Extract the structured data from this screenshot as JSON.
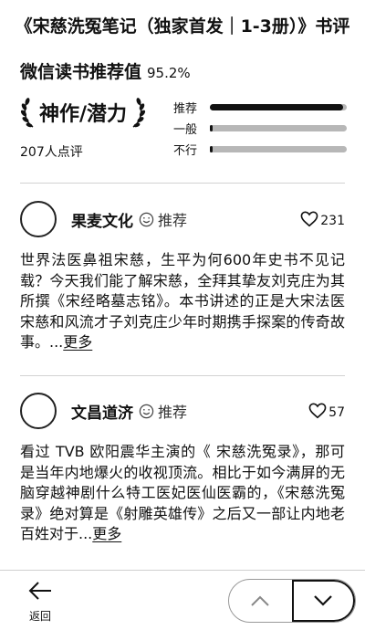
{
  "page": {
    "title": "《宋慈洗冤笔记（独家首发｜1-3册）》书评"
  },
  "rating": {
    "label": "微信读书推荐值",
    "value": "95.2%",
    "badge": "神作/潜力",
    "review_count": "207人点评",
    "bars": [
      {
        "label": "推荐",
        "fraction": 0.97
      },
      {
        "label": "一般",
        "fraction": 0.02
      },
      {
        "label": "不行",
        "fraction": 0.02
      }
    ]
  },
  "reviews": [
    {
      "author": "果麦文化",
      "recommendation": "推荐",
      "likes": "231",
      "text": "世界法医鼻祖宋慈，生平为何600年史书不见记载？今天我们能了解宋慈，全拜其挚友刘克庄为其所撰《宋经略墓志铭》。本书讲述的正是大宋法医宋慈和风流才子刘克庄少年时期携手探案的传奇故事。...",
      "more": "更多"
    },
    {
      "author": "文昌道济",
      "recommendation": "推荐",
      "likes": "57",
      "text": "看过 TVB 欧阳震华主演的《 宋慈洗冤录》，那可是当年内地爆火的收视顶流。相比于如今满屏的无脑穿越神剧什么特工医妃医仙医霸的，《宋慈洗冤录》绝对算是《射雕英雄传》之后又一部让内地老百姓对于...",
      "more": "更多"
    }
  ],
  "bottom": {
    "back_label": "返回"
  },
  "colors": {
    "text": "#111111",
    "bar_track": "#b7b7b7",
    "divider": "#d2d2d2"
  },
  "icons": [
    "laurel-left-icon",
    "laurel-right-icon",
    "smile-icon",
    "heart-icon",
    "back-arrow-icon",
    "chevron-up-icon",
    "chevron-down-icon"
  ]
}
